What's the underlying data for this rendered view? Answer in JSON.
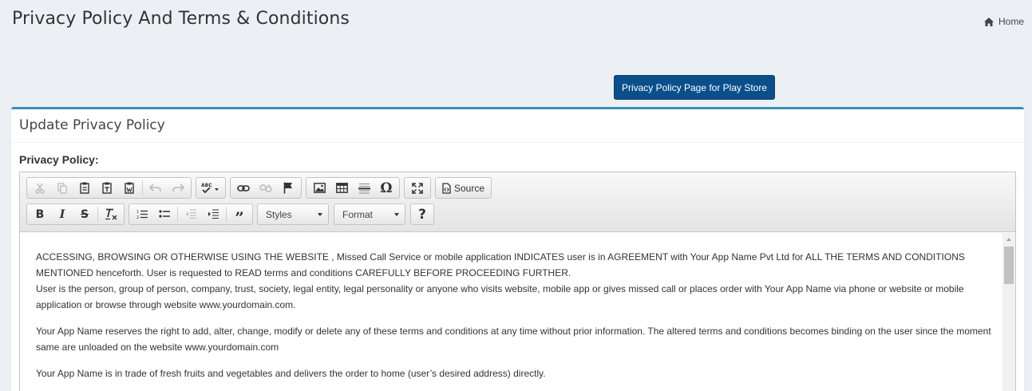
{
  "page": {
    "title": "Privacy Policy And Terms & Conditions",
    "breadcrumb_home": "Home"
  },
  "actions": {
    "play_store_button": "Privacy Policy Page for Play Store"
  },
  "box": {
    "title": "Update Privacy Policy",
    "field_label": "Privacy Policy:"
  },
  "toolbar": {
    "row1": [
      {
        "group": [
          "cut-icon",
          "copy-icon",
          "paste-icon",
          "paste-text-icon",
          "paste-word-icon"
        ]
      },
      {
        "group": [
          "undo-icon",
          "redo-icon"
        ]
      },
      {
        "group": [
          "spellcheck-icon"
        ]
      },
      {
        "group": [
          "link-icon",
          "unlink-icon",
          "anchor-icon"
        ]
      },
      {
        "group": [
          "image-icon",
          "table-icon",
          "horizontal-line-icon",
          "special-char-icon"
        ]
      },
      {
        "group": [
          "maximize-icon"
        ]
      },
      {
        "group": [
          "source-icon"
        ]
      }
    ],
    "source_label": "Source",
    "styles_label": "Styles",
    "format_label": "Format",
    "help_label": "?"
  },
  "content": {
    "paragraphs": [
      "ACCESSING, BROWSING OR OTHERWISE USING THE WEBSITE , Missed Call Service or mobile application INDICATES user is in AGREEMENT with Your App Name  Pvt Ltd for ALL THE TERMS AND CONDITIONS MENTIONED henceforth. User is requested to READ terms and conditions CAREFULLY BEFORE PROCEEDING FURTHER.",
      "User is the person, group of person, company, trust, society, legal entity, legal personality or anyone who visits website, mobile app or gives missed call or places order with Your App Name via phone or website or mobile application or browse through website www.yourdomain.com.",
      "Your App Name reserves the right to add, alter, change, modify or delete any of these terms and conditions at any time without prior information. The altered terms and conditions becomes binding on the user since the moment same are unloaded on the website www.yourdomain.com",
      "Your App Name is in trade of fresh fruits and vegetables and delivers the order to home (user’s desired address) directly."
    ]
  },
  "colors": {
    "accent": "#3c8dbc",
    "primary_button": "#0a4f8c",
    "background": "#ecf0f5"
  }
}
